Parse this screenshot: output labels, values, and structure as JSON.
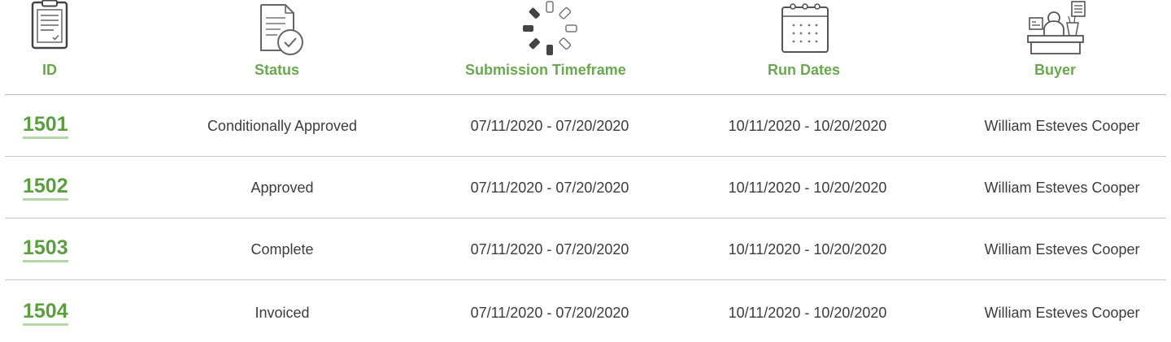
{
  "columns": [
    {
      "label": "ID",
      "icon": "clipboard-icon"
    },
    {
      "label": "Status",
      "icon": "document-check-icon"
    },
    {
      "label": "Submission Timeframe",
      "icon": "loading-circle-icon"
    },
    {
      "label": "Run Dates",
      "icon": "calendar-icon"
    },
    {
      "label": "Buyer",
      "icon": "buyer-desk-icon"
    }
  ],
  "rows": [
    {
      "id": "1501",
      "status": "Conditionally Approved",
      "submission": "07/11/2020 - 07/20/2020",
      "run_dates": "10/11/2020 - 10/20/2020",
      "buyer": "William Esteves Cooper"
    },
    {
      "id": "1502",
      "status": "Approved",
      "submission": "07/11/2020 - 07/20/2020",
      "run_dates": "10/11/2020 - 10/20/2020",
      "buyer": "William Esteves Cooper"
    },
    {
      "id": "1503",
      "status": "Complete",
      "submission": "07/11/2020 - 07/20/2020",
      "run_dates": "10/11/2020 - 10/20/2020",
      "buyer": "William Esteves Cooper"
    },
    {
      "id": "1504",
      "status": "Invoiced",
      "submission": "07/11/2020 - 07/20/2020",
      "run_dates": "10/11/2020 - 10/20/2020",
      "buyer": "William Esteves Cooper"
    }
  ],
  "colors": {
    "accent": "#6aa84f",
    "link": "#5a9e3e",
    "divider": "#c8c8c8"
  }
}
